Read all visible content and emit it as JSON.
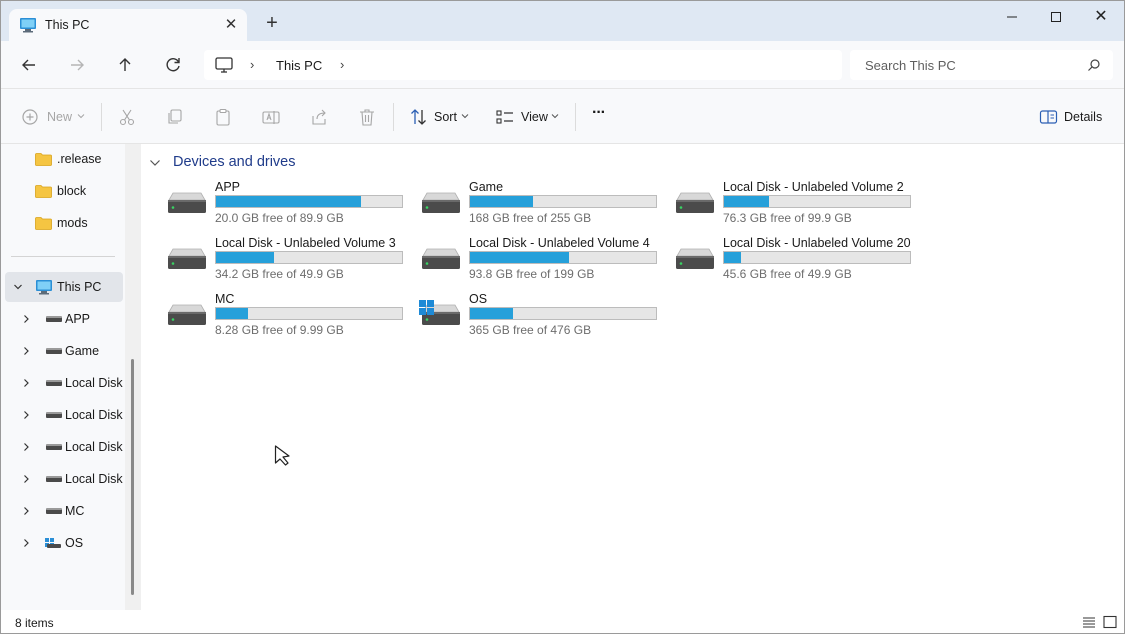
{
  "titlebar": {
    "tab_title": "This PC",
    "close_tab_glyph": "✕",
    "new_tab_glyph": "+",
    "minimize_glyph": "—",
    "close_glyph": "✕"
  },
  "address": {
    "path_label": "This PC",
    "separator": "›",
    "search_placeholder": "Search This PC"
  },
  "commands": {
    "new": "New",
    "sort": "Sort",
    "view": "View",
    "more": "···",
    "details": "Details"
  },
  "sidebar": {
    "folders": [
      ".release",
      "block",
      "mods"
    ],
    "this_pc": "This PC",
    "drives": [
      "APP",
      "Game",
      "Local Disk -",
      "Local Disk -",
      "Local Disk -",
      "Local Disk -",
      "MC",
      "OS"
    ]
  },
  "content": {
    "group_title": "Devices and drives",
    "drives": [
      {
        "name": "APP",
        "free": "20.0 GB free of 89.9 GB",
        "used_fraction": 0.78
      },
      {
        "name": "Game",
        "free": "168 GB free of 255 GB",
        "used_fraction": 0.34
      },
      {
        "name": "Local Disk - Unlabeled Volume 2",
        "free": "76.3 GB free of 99.9 GB",
        "used_fraction": 0.24
      },
      {
        "name": "Local Disk - Unlabeled Volume 3",
        "free": "34.2 GB free of 49.9 GB",
        "used_fraction": 0.31
      },
      {
        "name": "Local Disk - Unlabeled Volume 4",
        "free": "93.8 GB free of 199 GB",
        "used_fraction": 0.53
      },
      {
        "name": "Local Disk - Unlabeled Volume 20",
        "free": "45.6 GB free of 49.9 GB",
        "used_fraction": 0.09
      },
      {
        "name": "MC",
        "free": "8.28 GB free of 9.99 GB",
        "used_fraction": 0.17
      },
      {
        "name": "OS",
        "free": "365 GB free of 476 GB",
        "used_fraction": 0.23
      }
    ]
  },
  "status": {
    "items_count": "8 items"
  },
  "colors": {
    "accent_bar": "#26a0da",
    "titlebar_bg": "#dfe8f3",
    "group_title": "#1f3b8a"
  }
}
